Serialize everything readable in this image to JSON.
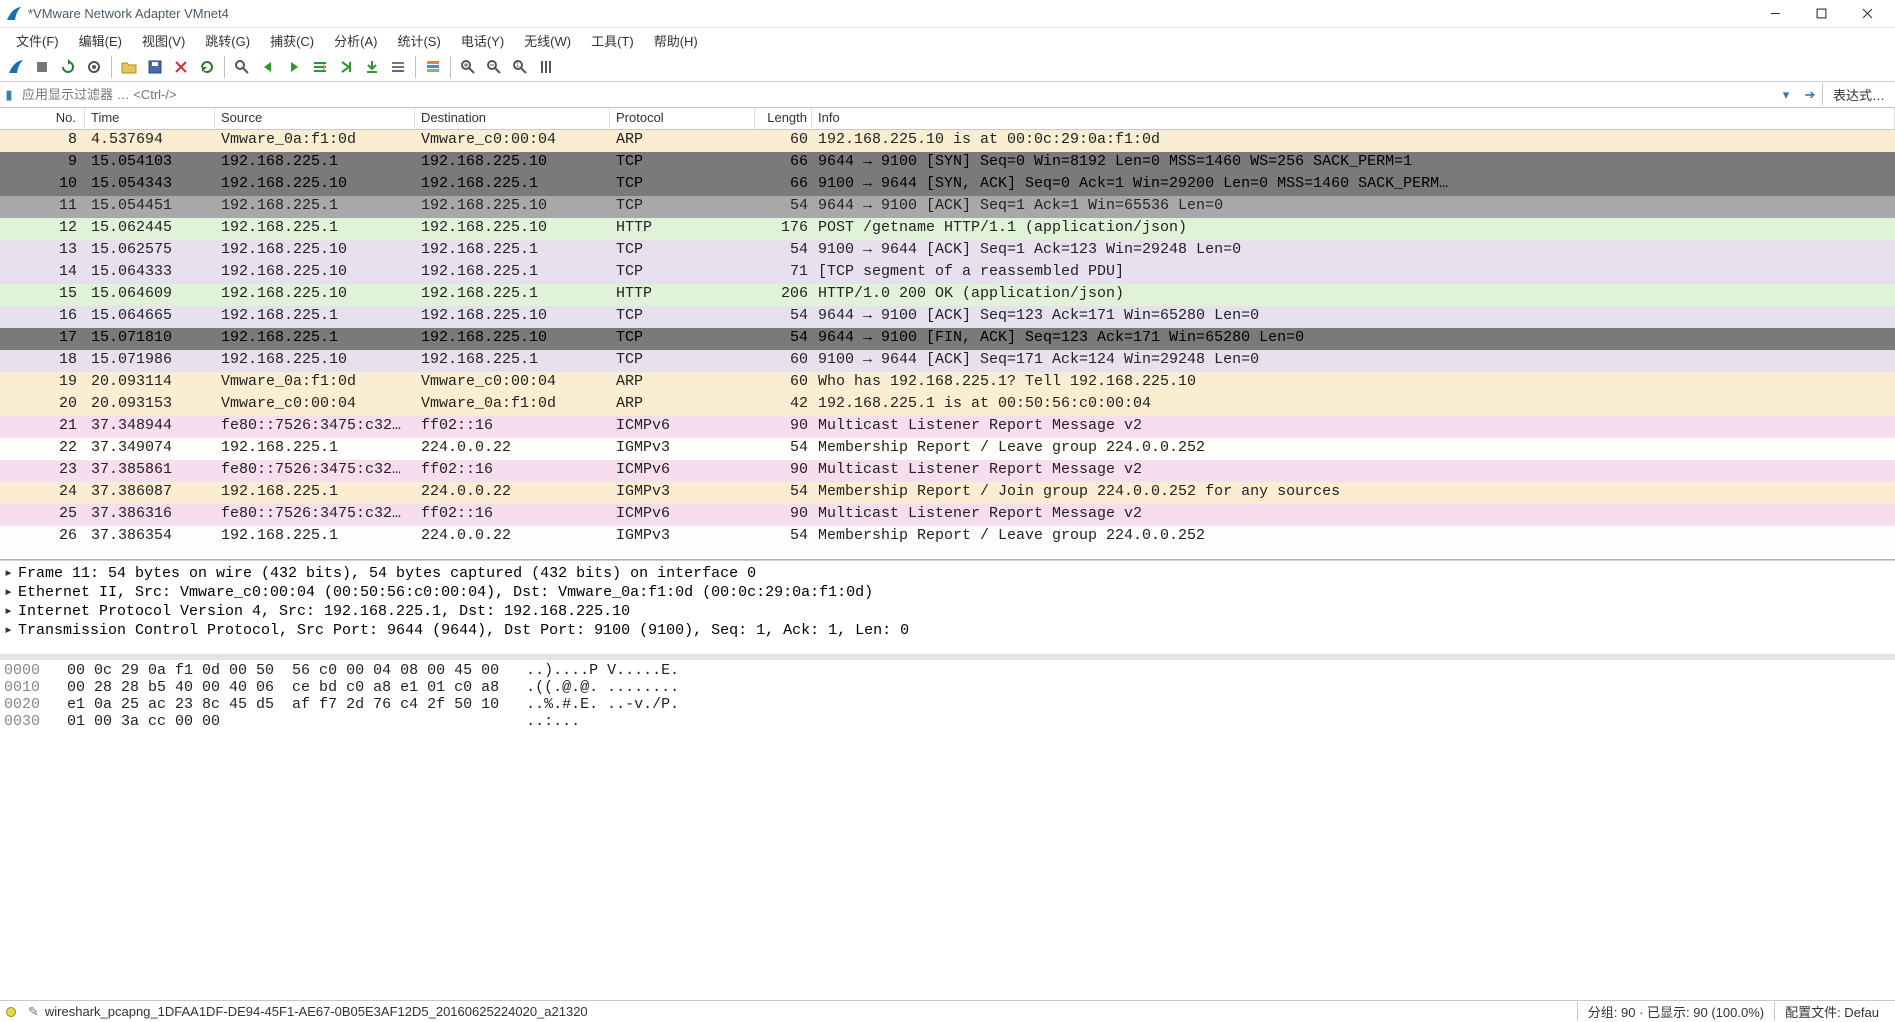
{
  "window": {
    "title": "*VMware Network Adapter VMnet4"
  },
  "menu": {
    "file": "文件(F)",
    "edit": "编辑(E)",
    "view": "视图(V)",
    "go": "跳转(G)",
    "capture": "捕获(C)",
    "analyze": "分析(A)",
    "statistics": "统计(S)",
    "telephony": "电话(Y)",
    "wireless": "无线(W)",
    "tools": "工具(T)",
    "help": "帮助(H)"
  },
  "filterbar": {
    "placeholder": "应用显示过滤器 … <Ctrl-/>",
    "expression": "表达式…"
  },
  "columns": {
    "no": "No.",
    "time": "Time",
    "source": "Source",
    "destination": "Destination",
    "protocol": "Protocol",
    "length": "Length",
    "info": "Info"
  },
  "packets": [
    {
      "no": "8",
      "time": "4.537694",
      "src": "Vmware_0a:f1:0d",
      "dst": "Vmware_c0:00:04",
      "proto": "ARP",
      "len": "60",
      "info": "192.168.225.10 is at 00:0c:29:0a:f1:0d",
      "cls": "bg-beige"
    },
    {
      "no": "9",
      "time": "15.054103",
      "src": "192.168.225.1",
      "dst": "192.168.225.10",
      "proto": "TCP",
      "len": "66",
      "info": "9644 → 9100 [SYN] Seq=0 Win=8192 Len=0 MSS=1460 WS=256 SACK_PERM=1",
      "cls": "bg-grey"
    },
    {
      "no": "10",
      "time": "15.054343",
      "src": "192.168.225.10",
      "dst": "192.168.225.1",
      "proto": "TCP",
      "len": "66",
      "info": "9100 → 9644 [SYN, ACK] Seq=0 Ack=1 Win=29200 Len=0 MSS=1460 SACK_PERM…",
      "cls": "bg-grey"
    },
    {
      "no": "11",
      "time": "15.054451",
      "src": "192.168.225.1",
      "dst": "192.168.225.10",
      "proto": "TCP",
      "len": "54",
      "info": "9644 → 9100 [ACK] Seq=1 Ack=1 Win=65536 Len=0",
      "cls": "bg-lilac",
      "selected": true
    },
    {
      "no": "12",
      "time": "15.062445",
      "src": "192.168.225.1",
      "dst": "192.168.225.10",
      "proto": "HTTP",
      "len": "176",
      "info": "POST /getname HTTP/1.1  (application/json)",
      "cls": "bg-green"
    },
    {
      "no": "13",
      "time": "15.062575",
      "src": "192.168.225.10",
      "dst": "192.168.225.1",
      "proto": "TCP",
      "len": "54",
      "info": "9100 → 9644 [ACK] Seq=1 Ack=123 Win=29248 Len=0",
      "cls": "bg-lilac"
    },
    {
      "no": "14",
      "time": "15.064333",
      "src": "192.168.225.10",
      "dst": "192.168.225.1",
      "proto": "TCP",
      "len": "71",
      "info": "[TCP segment of a reassembled PDU]",
      "cls": "bg-lilac"
    },
    {
      "no": "15",
      "time": "15.064609",
      "src": "192.168.225.10",
      "dst": "192.168.225.1",
      "proto": "HTTP",
      "len": "206",
      "info": "HTTP/1.0 200 OK  (application/json)",
      "cls": "bg-green"
    },
    {
      "no": "16",
      "time": "15.064665",
      "src": "192.168.225.1",
      "dst": "192.168.225.10",
      "proto": "TCP",
      "len": "54",
      "info": "9644 → 9100 [ACK] Seq=123 Ack=171 Win=65280 Len=0",
      "cls": "bg-lilac"
    },
    {
      "no": "17",
      "time": "15.071810",
      "src": "192.168.225.1",
      "dst": "192.168.225.10",
      "proto": "TCP",
      "len": "54",
      "info": "9644 → 9100 [FIN, ACK] Seq=123 Ack=171 Win=65280 Len=0",
      "cls": "bg-grey"
    },
    {
      "no": "18",
      "time": "15.071986",
      "src": "192.168.225.10",
      "dst": "192.168.225.1",
      "proto": "TCP",
      "len": "60",
      "info": "9100 → 9644 [ACK] Seq=171 Ack=124 Win=29248 Len=0",
      "cls": "bg-lilac"
    },
    {
      "no": "19",
      "time": "20.093114",
      "src": "Vmware_0a:f1:0d",
      "dst": "Vmware_c0:00:04",
      "proto": "ARP",
      "len": "60",
      "info": "Who has 192.168.225.1? Tell 192.168.225.10",
      "cls": "bg-beige"
    },
    {
      "no": "20",
      "time": "20.093153",
      "src": "Vmware_c0:00:04",
      "dst": "Vmware_0a:f1:0d",
      "proto": "ARP",
      "len": "42",
      "info": "192.168.225.1 is at 00:50:56:c0:00:04",
      "cls": "bg-beige"
    },
    {
      "no": "21",
      "time": "37.348944",
      "src": "fe80::7526:3475:c32…",
      "dst": "ff02::16",
      "proto": "ICMPv6",
      "len": "90",
      "info": "Multicast Listener Report Message v2",
      "cls": "bg-pink"
    },
    {
      "no": "22",
      "time": "37.349074",
      "src": "192.168.225.1",
      "dst": "224.0.0.22",
      "proto": "IGMPv3",
      "len": "54",
      "info": "Membership Report / Leave group 224.0.0.252",
      "cls": "bg-white"
    },
    {
      "no": "23",
      "time": "37.385861",
      "src": "fe80::7526:3475:c32…",
      "dst": "ff02::16",
      "proto": "ICMPv6",
      "len": "90",
      "info": "Multicast Listener Report Message v2",
      "cls": "bg-pink"
    },
    {
      "no": "24",
      "time": "37.386087",
      "src": "192.168.225.1",
      "dst": "224.0.0.22",
      "proto": "IGMPv3",
      "len": "54",
      "info": "Membership Report / Join group 224.0.0.252 for any sources",
      "cls": "bg-beige"
    },
    {
      "no": "25",
      "time": "37.386316",
      "src": "fe80::7526:3475:c32…",
      "dst": "ff02::16",
      "proto": "ICMPv6",
      "len": "90",
      "info": "Multicast Listener Report Message v2",
      "cls": "bg-pink"
    },
    {
      "no": "26",
      "time": "37.386354",
      "src": "192.168.225.1",
      "dst": "224.0.0.22",
      "proto": "IGMPv3",
      "len": "54",
      "info": "Membership Report / Leave group 224.0.0.252",
      "cls": "bg-white"
    }
  ],
  "details": [
    "Frame 11: 54 bytes on wire (432 bits), 54 bytes captured (432 bits) on interface 0",
    "Ethernet II, Src: Vmware_c0:00:04 (00:50:56:c0:00:04), Dst: Vmware_0a:f1:0d (00:0c:29:0a:f1:0d)",
    "Internet Protocol Version 4, Src: 192.168.225.1, Dst: 192.168.225.10",
    "Transmission Control Protocol, Src Port: 9644 (9644), Dst Port: 9100 (9100), Seq: 1, Ack: 1, Len: 0"
  ],
  "hex": [
    {
      "off": "0000",
      "b": "00 0c 29 0a f1 0d 00 50  56 c0 00 04 08 00 45 00",
      "a": "..)....P V.....E."
    },
    {
      "off": "0010",
      "b": "00 28 28 b5 40 00 40 06  ce bd c0 a8 e1 01 c0 a8",
      "a": ".((.@.@. ........"
    },
    {
      "off": "0020",
      "b": "e1 0a 25 ac 23 8c 45 d5  af f7 2d 76 c4 2f 50 10",
      "a": "..%.#.E. ..-v./P."
    },
    {
      "off": "0030",
      "b": "01 00 3a cc 00 00",
      "a": "..:..."
    }
  ],
  "status": {
    "file": "wireshark_pcapng_1DFAA1DF-DE94-45F1-AE67-0B05E3AF12D5_20160625224020_a21320",
    "packets": "分组: 90  · 已显示: 90 (100.0%)",
    "profile": "配置文件: Defau"
  }
}
